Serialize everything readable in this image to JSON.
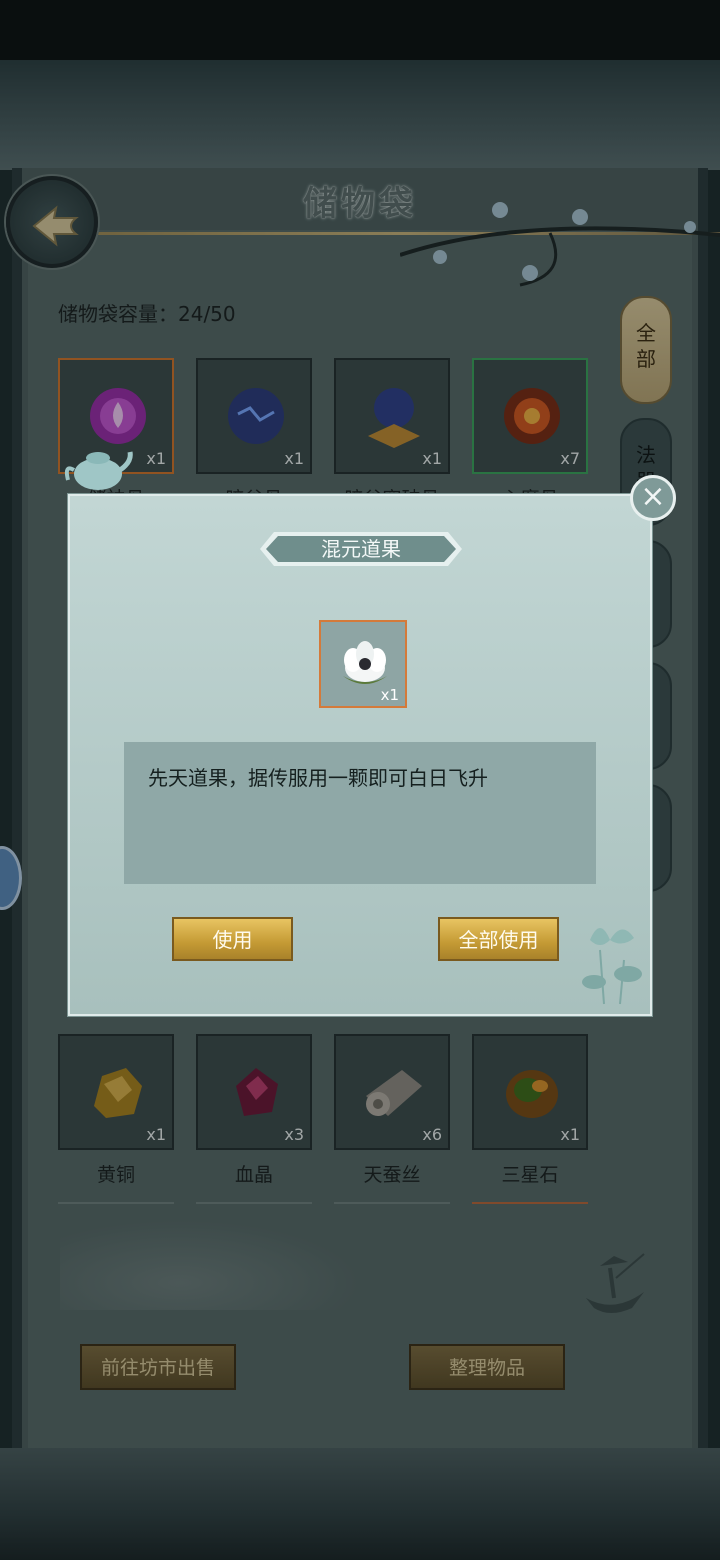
{
  "page": {
    "title": "储物袋",
    "capacity_label": "储物袋容量：24/50"
  },
  "category_tabs": [
    {
      "label": "全\n部",
      "active": true
    },
    {
      "label": "法\n器",
      "active": false
    },
    {
      "label": "",
      "active": false
    },
    {
      "label": "",
      "active": false
    },
    {
      "label": "",
      "active": false
    }
  ],
  "inventory_top_row": [
    {
      "name": "储神丹",
      "count": "x1",
      "icon": "purple-orb-icon",
      "rarity": "orange"
    },
    {
      "name": "暗谷丹",
      "count": "x1",
      "icon": "blue-orb-icon",
      "rarity": "none"
    },
    {
      "name": "暗谷窥破丹",
      "count": "x1",
      "icon": "blue-orb-stand-icon",
      "rarity": "none"
    },
    {
      "name": "心魔丹",
      "count": "x7",
      "icon": "fire-orb-icon",
      "rarity": "green"
    }
  ],
  "inventory_bottom_row": [
    {
      "name": "黄铜",
      "count": "x1",
      "icon": "brass-ore-icon",
      "rarity": "none"
    },
    {
      "name": "血晶",
      "count": "x3",
      "icon": "blood-crystal-icon",
      "rarity": "none"
    },
    {
      "name": "天蚕丝",
      "count": "x6",
      "icon": "silk-scroll-icon",
      "rarity": "none"
    },
    {
      "name": "三星石",
      "count": "x1",
      "icon": "amber-stone-icon",
      "rarity": "orange"
    }
  ],
  "bottom_buttons": {
    "sell": "前往坊市出售",
    "sort": "整理物品"
  },
  "modal": {
    "title": "混元道果",
    "item_count": "x1",
    "item_icon": "white-lotus-fruit-icon",
    "description": "先天道果，据传服用一颗即可白日飞升",
    "use_label": "使用",
    "use_all_label": "全部使用",
    "close_icon": "close-icon"
  },
  "colors": {
    "accent_gold": "#c49a34",
    "rarity_orange": "#d2742a",
    "rarity_green": "#3aa35a",
    "panel_bg": "#566766",
    "modal_bg": "#b5cbc8"
  }
}
